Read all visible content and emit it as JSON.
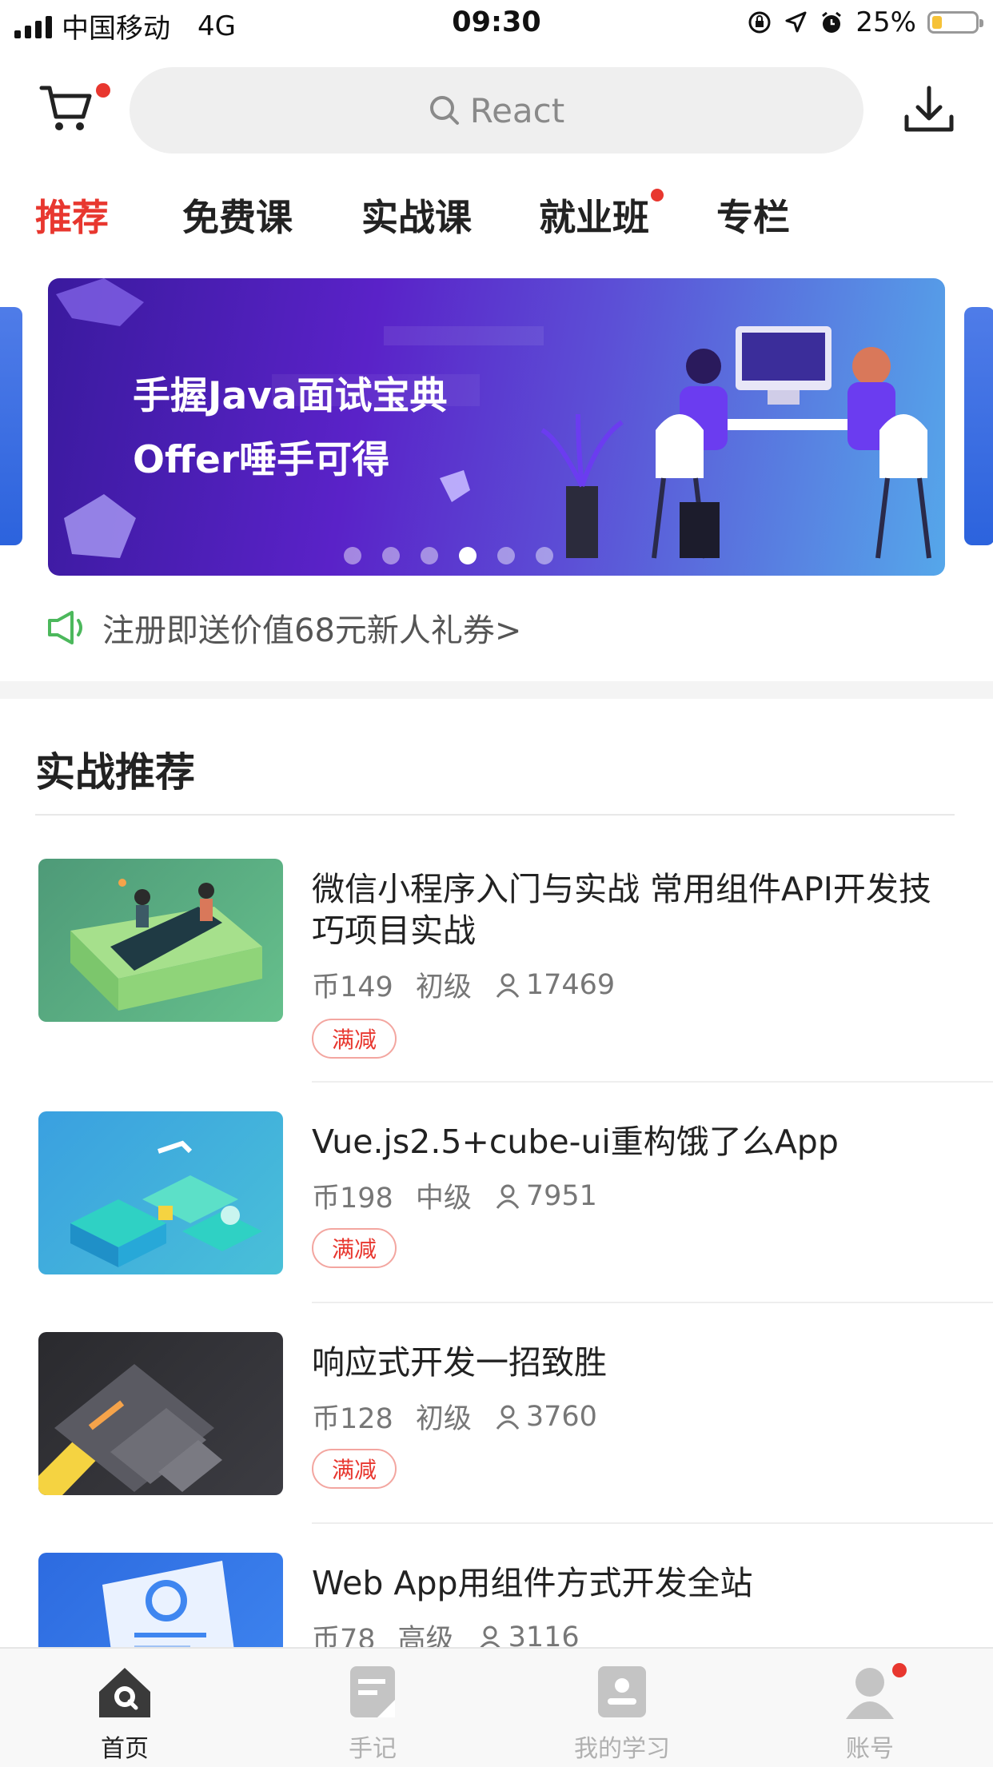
{
  "status_bar": {
    "carrier": "中国移动",
    "network": "4G",
    "time": "09:30",
    "battery": "25%"
  },
  "header": {
    "search_placeholder": "React"
  },
  "tabs": [
    {
      "label": "推荐",
      "active": true
    },
    {
      "label": "免费课",
      "active": false
    },
    {
      "label": "实战课",
      "active": false
    },
    {
      "label": "就业班",
      "active": false,
      "has_dot": true
    },
    {
      "label": "专栏",
      "active": false
    }
  ],
  "banner": {
    "line1": "手握Java面试宝典",
    "line2": "Offer唾手可得",
    "dot_count": 6,
    "active_dot": 4
  },
  "promo": {
    "text": "注册即送价值68元新人礼券>"
  },
  "section": {
    "title": "实战推荐"
  },
  "courses": [
    {
      "title": "微信小程序入门与实战 常用组件API开发技巧项目实战",
      "price": "币149",
      "level": "初级",
      "learners": "17469",
      "tag": "满减"
    },
    {
      "title": "Vue.js2.5+cube-ui重构饿了么App",
      "price": "币198",
      "level": "中级",
      "learners": "7951",
      "tag": "满减"
    },
    {
      "title": "响应式开发一招致胜",
      "price": "币128",
      "level": "初级",
      "learners": "3760",
      "tag": "满减"
    },
    {
      "title": "Web App用组件方式开发全站",
      "price": "币78",
      "level": "高级",
      "learners": "3116"
    }
  ],
  "bottom_nav": [
    {
      "label": "首页",
      "icon": "home-icon",
      "active": true
    },
    {
      "label": "手记",
      "icon": "notes-icon",
      "active": false
    },
    {
      "label": "我的学习",
      "icon": "learning-icon",
      "active": false
    },
    {
      "label": "账号",
      "icon": "account-icon",
      "active": false,
      "has_dot": true
    }
  ],
  "colors": {
    "accent": "#e8372f",
    "promo_icon": "#4cb85c"
  }
}
